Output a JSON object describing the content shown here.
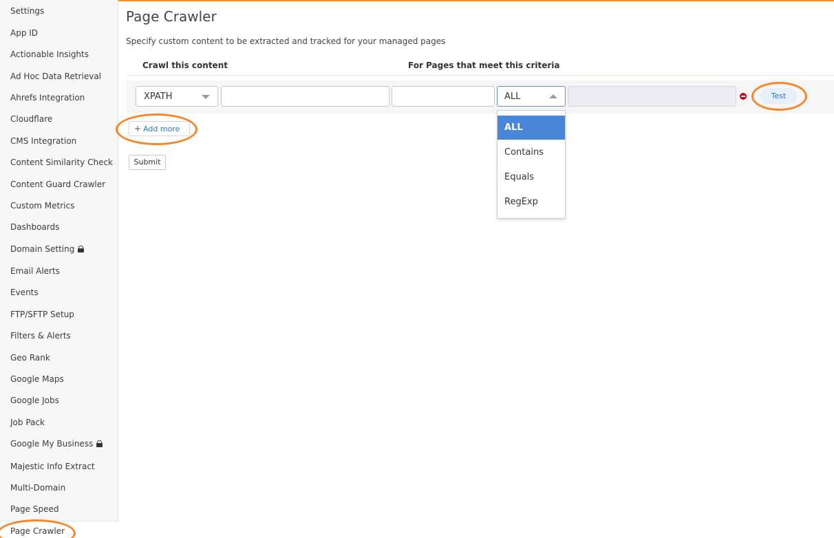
{
  "sidebar": {
    "items": [
      {
        "label": "Settings"
      },
      {
        "label": "App ID"
      },
      {
        "label": "Actionable Insights"
      },
      {
        "label": "Ad Hoc Data Retrieval"
      },
      {
        "label": "Ahrefs Integration"
      },
      {
        "label": "Cloudflare"
      },
      {
        "label": "CMS Integration"
      },
      {
        "label": "Content Similarity Check"
      },
      {
        "label": "Content Guard Crawler"
      },
      {
        "label": "Custom Metrics"
      },
      {
        "label": "Dashboards"
      },
      {
        "label": "Domain Setting",
        "icon": "lock-icon"
      },
      {
        "label": "Email Alerts"
      },
      {
        "label": "Events"
      },
      {
        "label": "FTP/SFTP Setup"
      },
      {
        "label": "Filters & Alerts"
      },
      {
        "label": "Geo Rank"
      },
      {
        "label": "Google Maps"
      },
      {
        "label": "Google Jobs"
      },
      {
        "label": "Job Pack"
      },
      {
        "label": "Google My Business",
        "icon": "lock-icon"
      },
      {
        "label": "Majestic Info Extract"
      },
      {
        "label": "Multi-Domain"
      },
      {
        "label": "Page Speed"
      },
      {
        "label": "Page Crawler"
      }
    ]
  },
  "main": {
    "title": "Page Crawler",
    "description": "Specify custom content to be extracted and tracked for your managed pages",
    "col_crawl": "Crawl this content",
    "col_criteria": "For Pages that meet this criteria",
    "row": {
      "type_select": "XPATH",
      "content_value": "",
      "page_value": "",
      "criteria_select": "ALL",
      "criteria_value": "",
      "remove_icon": "remove-circle-icon",
      "test_label": "Test"
    },
    "dropdown_options": [
      "ALL",
      "Contains",
      "Equals",
      "RegExp"
    ],
    "add_more_label": "Add more",
    "add_more_icon": "plus-icon",
    "submit_label": "Submit"
  },
  "colors": {
    "accent_orange": "#f7862a",
    "link_blue": "#2a7ac0",
    "selected_blue": "#4a86d8",
    "remove_red": "#d0021b"
  }
}
